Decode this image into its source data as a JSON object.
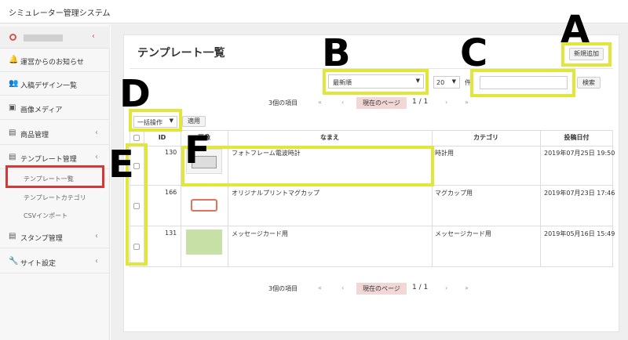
{
  "app": {
    "title": "シミュレーター管理システム"
  },
  "sidebar": {
    "items": [
      {
        "label": "運営からのお知らせ",
        "icon": "bell-icon"
      },
      {
        "label": "入稿デザイン一覧",
        "icon": "users-icon"
      },
      {
        "label": "画像メディア",
        "icon": "image-icon"
      },
      {
        "label": "商品管理",
        "icon": "database-icon"
      },
      {
        "label": "テンプレート管理",
        "icon": "database-icon"
      },
      {
        "label": "スタンプ管理",
        "icon": "database-icon"
      },
      {
        "label": "サイト設定",
        "icon": "wrench-icon"
      }
    ],
    "subitems": [
      "テンプレート一覧",
      "テンプレートカテゴリ",
      "CSVインポート"
    ]
  },
  "main": {
    "title": "テンプレート一覧",
    "new_button": "新規追加",
    "sort_select": "最新順",
    "per_page": "20",
    "per_page_suffix": "件",
    "search_button": "検索",
    "search_placeholder": "",
    "bulk_select": "一括操作",
    "apply_button": "適用",
    "item_count": "3個の項目",
    "current_page_label": "現在のページ",
    "page_info": "1 / 1",
    "table": {
      "headers": [
        "ID",
        "画像",
        "なまえ",
        "カテゴリ",
        "投稿日付"
      ],
      "rows": [
        {
          "id": "130",
          "name": "フォトフレーム電波時計",
          "category": "時計用",
          "date": "2019年07月25日 19:50"
        },
        {
          "id": "166",
          "name": "オリジナルプリントマグカップ",
          "category": "マグカップ用",
          "date": "2019年07月23日 17:46"
        },
        {
          "id": "131",
          "name": "メッセージカード用",
          "category": "メッセージカード用",
          "date": "2019年05月16日 15:49"
        }
      ]
    }
  },
  "annotations": {
    "A": "A",
    "B": "B",
    "C": "C",
    "D": "D",
    "E": "E",
    "F": "F"
  },
  "colors": {
    "highlight": "#e1e63a",
    "sidebar_active_border": "#d93636",
    "current_page_bg": "#f2d7d7"
  }
}
